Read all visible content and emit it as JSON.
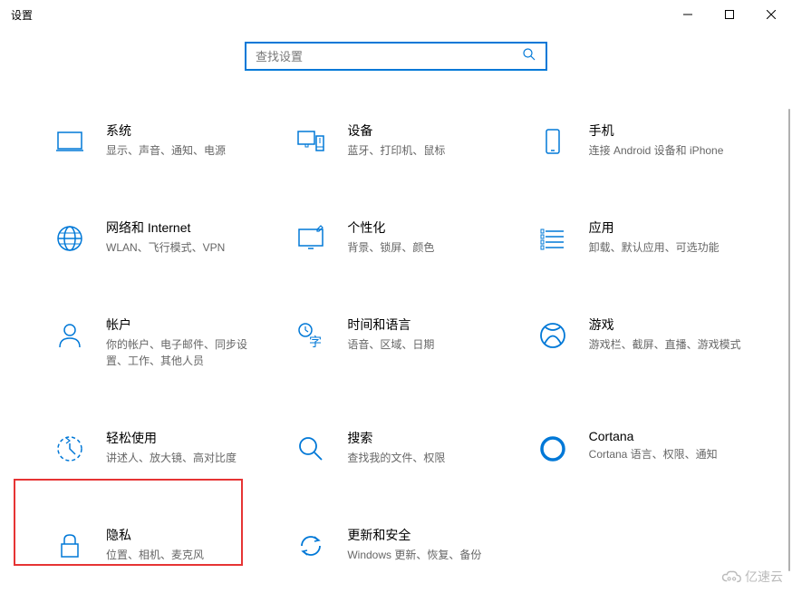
{
  "window": {
    "title": "设置"
  },
  "search": {
    "placeholder": "查找设置"
  },
  "tiles": [
    {
      "id": "system",
      "title": "系统",
      "sub": "显示、声音、通知、电源"
    },
    {
      "id": "devices",
      "title": "设备",
      "sub": "蓝牙、打印机、鼠标"
    },
    {
      "id": "phone",
      "title": "手机",
      "sub": "连接 Android 设备和 iPhone"
    },
    {
      "id": "network",
      "title": "网络和 Internet",
      "sub": "WLAN、飞行模式、VPN"
    },
    {
      "id": "personalization",
      "title": "个性化",
      "sub": "背景、锁屏、颜色"
    },
    {
      "id": "apps",
      "title": "应用",
      "sub": "卸载、默认应用、可选功能"
    },
    {
      "id": "accounts",
      "title": "帐户",
      "sub": "你的帐户、电子邮件、同步设置、工作、其他人员"
    },
    {
      "id": "time",
      "title": "时间和语言",
      "sub": "语音、区域、日期"
    },
    {
      "id": "gaming",
      "title": "游戏",
      "sub": "游戏栏、截屏、直播、游戏模式"
    },
    {
      "id": "ease",
      "title": "轻松使用",
      "sub": "讲述人、放大镜、高对比度"
    },
    {
      "id": "search-cat",
      "title": "搜索",
      "sub": "查找我的文件、权限"
    },
    {
      "id": "cortana",
      "title": "Cortana",
      "sub": "Cortana 语言、权限、通知"
    },
    {
      "id": "privacy",
      "title": "隐私",
      "sub": "位置、相机、麦克风"
    },
    {
      "id": "update",
      "title": "更新和安全",
      "sub": "Windows 更新、恢复、备份"
    }
  ],
  "watermark": "亿速云"
}
